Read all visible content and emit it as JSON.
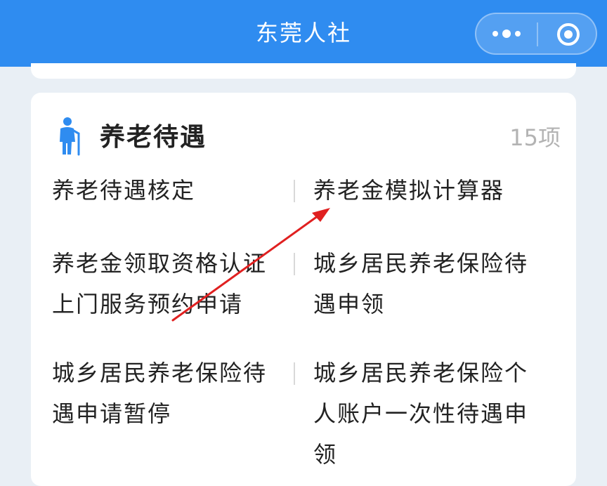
{
  "header": {
    "title": "东莞人社",
    "menu_icon": "more-dots-icon",
    "close_icon": "target-close-icon"
  },
  "section": {
    "title": "养老待遇",
    "count": "15项",
    "icon": "elderly-person-icon",
    "items": [
      "养老待遇核定",
      "养老金模拟计算器",
      "养老金领取资格认证上门服务预约申请",
      "城乡居民养老保险待遇申领",
      "城乡居民养老保险待遇申请暂停",
      "城乡居民养老保险个人账户一次性待遇申领"
    ]
  },
  "colors": {
    "header_bg": "#2f8cf0",
    "page_bg": "#e9eff5",
    "icon_blue": "#2f8cf0",
    "annotation_red": "#e02020"
  }
}
